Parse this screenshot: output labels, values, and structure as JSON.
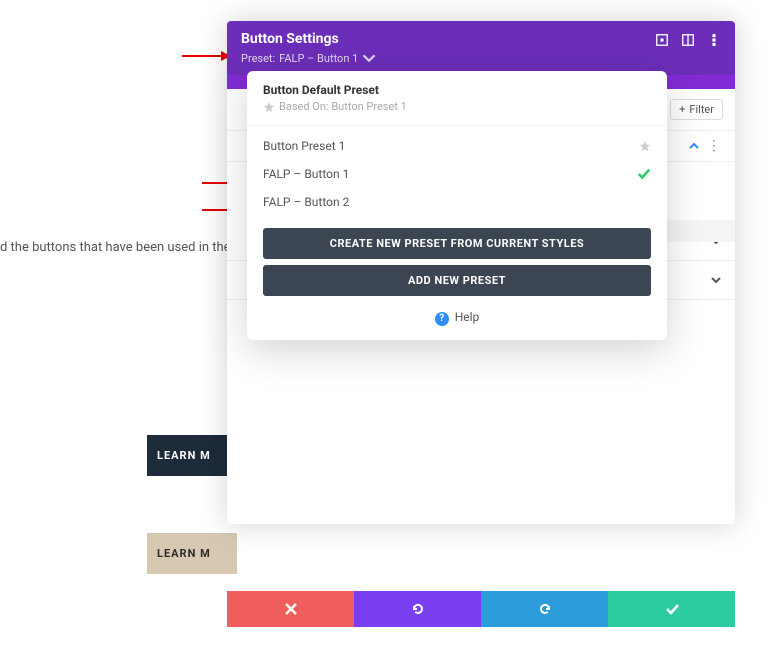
{
  "bg": {
    "description": "d the buttons that have been used in the l",
    "learn1": "LEARN M",
    "learn2": "LEARN M"
  },
  "header": {
    "title": "Button Settings",
    "preset_prefix": "Preset: ",
    "preset_name": "FALP – Button 1"
  },
  "dropdown": {
    "default_title": "Button Default Preset",
    "based_on_label": "Based On: Button Preset 1",
    "items": [
      {
        "label": "Button Preset 1",
        "starred": true,
        "checked": false
      },
      {
        "label": "FALP – Button 1",
        "starred": false,
        "checked": true
      },
      {
        "label": "FALP – Button 2",
        "starred": false,
        "checked": false
      }
    ],
    "create_label": "CREATE NEW PRESET FROM CURRENT STYLES",
    "add_label": "ADD NEW PRESET",
    "help_label": "Help"
  },
  "panel": {
    "filter_label": "Filter",
    "help_label": "Help"
  }
}
